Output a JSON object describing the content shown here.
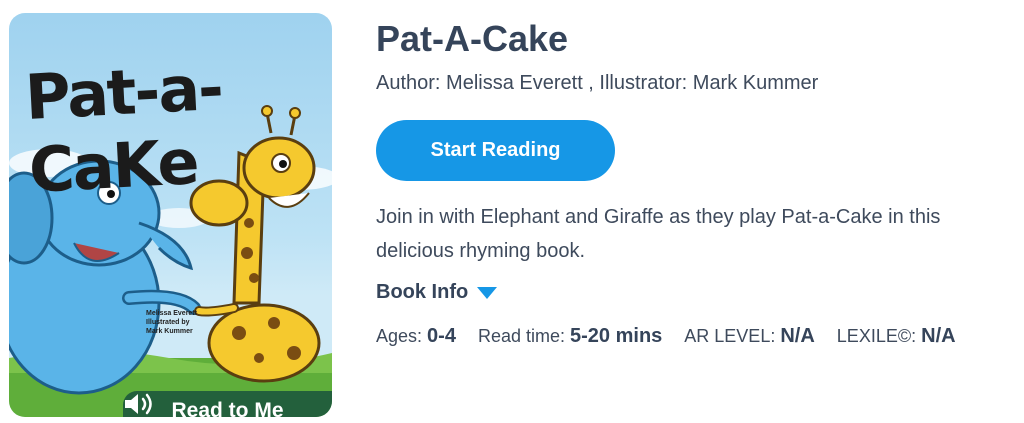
{
  "book": {
    "title": "Pat-A-Cake",
    "byline": "Author: Melissa Everett , Illustrator: Mark Kummer",
    "description": "Join in with Elephant and Giraffe as they play Pat-a-Cake in this delicious rhyming book.",
    "book_info_label": "Book Info"
  },
  "cover": {
    "title_main": "Pat-a-CaKe",
    "credit_author": "Melissa Everett",
    "credit_illustrated": "Illustrated by",
    "credit_illustrator": "Mark Kummer",
    "band_label": "Read to Me",
    "band_icon": "speaker-icon",
    "band_color": "#23603c"
  },
  "actions": {
    "start_reading": "Start Reading",
    "button_color": "#1697e6"
  },
  "meta": [
    {
      "label": "Ages:",
      "value": "0-4"
    },
    {
      "label": "Read time:",
      "value": "5-20 mins"
    },
    {
      "label": "AR LEVEL:",
      "value": "N/A"
    },
    {
      "label": "LEXILE©:",
      "value": "N/A"
    }
  ]
}
